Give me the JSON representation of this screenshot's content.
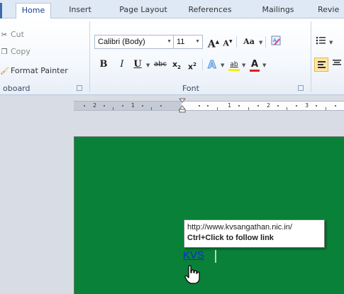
{
  "tabs": [
    "Home",
    "Insert",
    "Page Layout",
    "References",
    "Mailings",
    "Revie"
  ],
  "clipboard": {
    "cut": "Cut",
    "copy": "Copy",
    "format_painter": "Format Painter",
    "group_label": "oboard"
  },
  "font": {
    "family": "Calibri (Body)",
    "size": "11",
    "group_label": "Font",
    "grow": "A",
    "shrink": "A",
    "change_case": "Aa",
    "bold": "B",
    "italic": "I",
    "underline": "U",
    "strikethrough": "abc",
    "subscript": "x",
    "superscript": "x",
    "highlight": "ab",
    "font_color": "A"
  },
  "ruler": {
    "labels": [
      "2",
      "1",
      "1",
      "2",
      "3"
    ]
  },
  "document": {
    "tooltip_url": "http://www.kvsangathan.nic.in/",
    "tooltip_hint": "Ctrl+Click to follow link",
    "link_text": "KVS"
  },
  "colors": {
    "page_background": "#0a8139",
    "link": "#0b2bd6",
    "active_tab_text": "#15428b"
  }
}
